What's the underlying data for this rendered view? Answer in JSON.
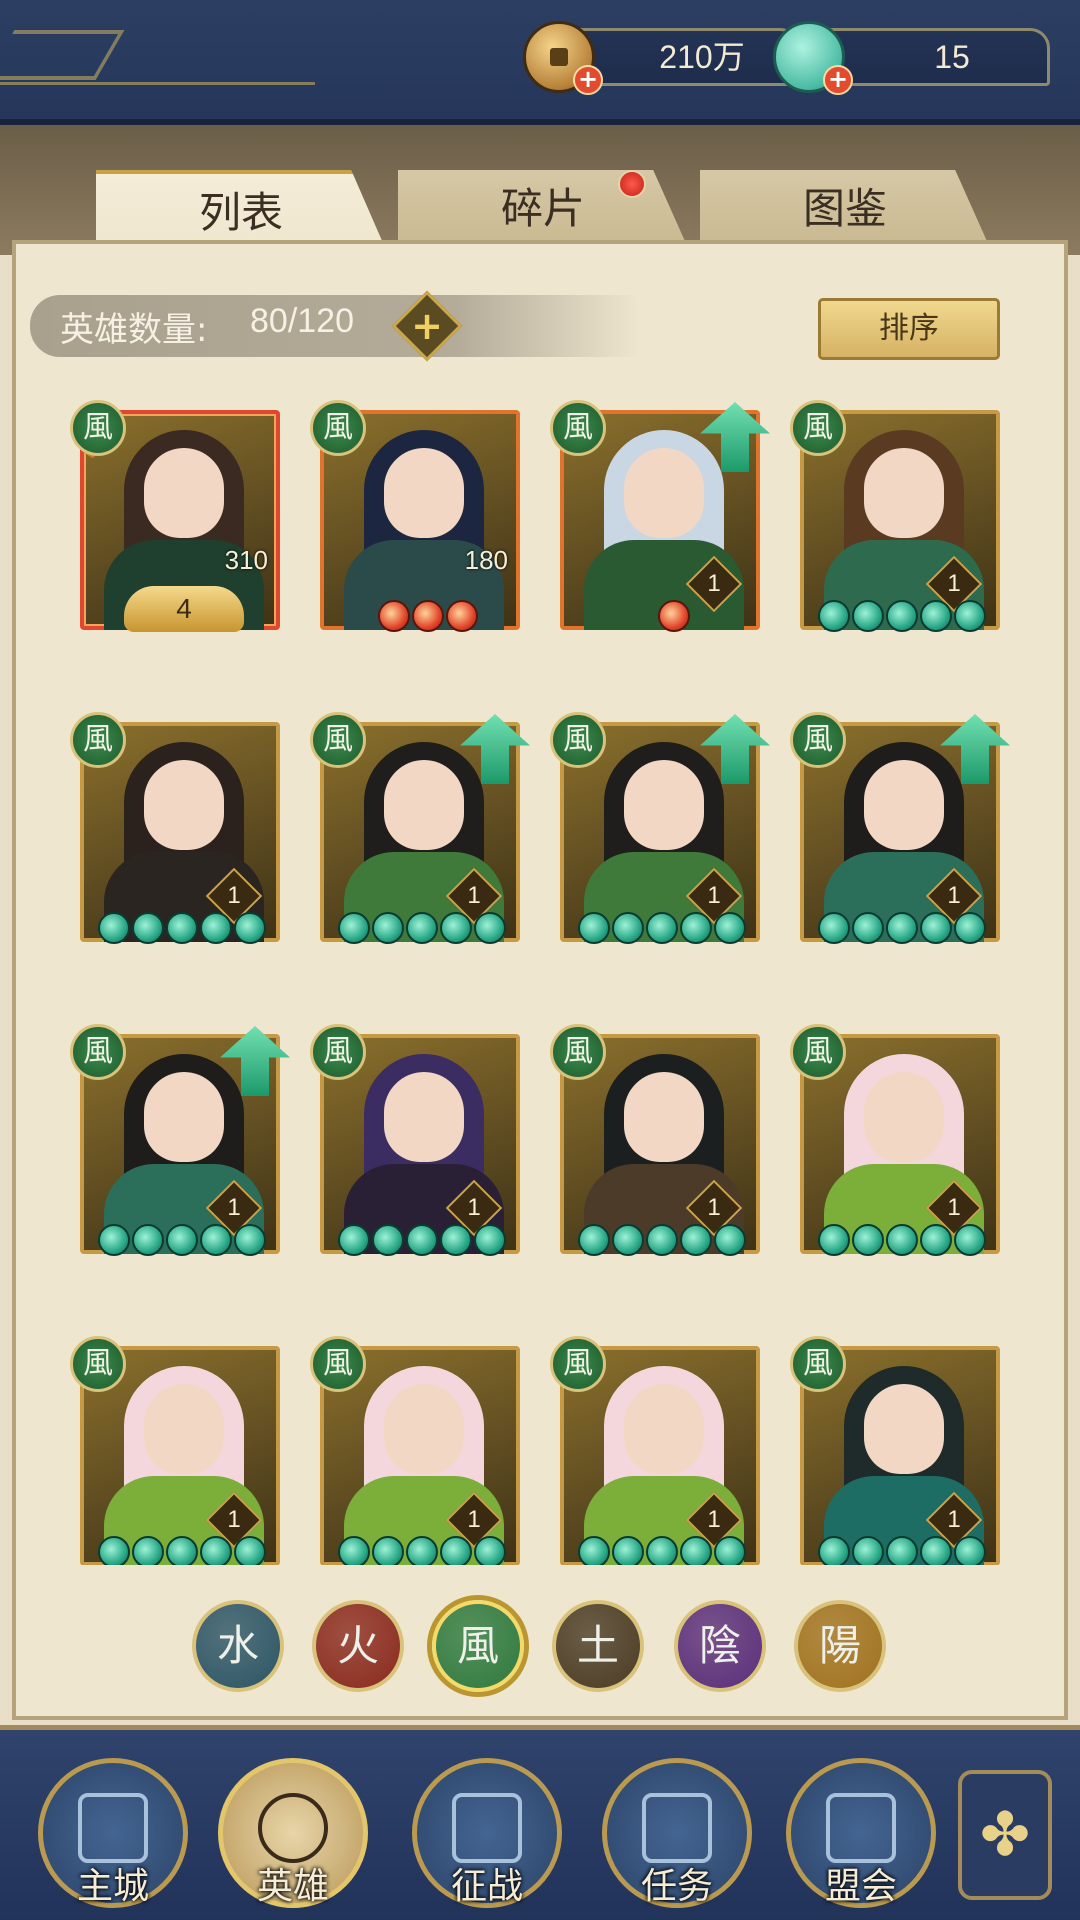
{
  "resources": {
    "coins": "210万",
    "shells": "15"
  },
  "tabs": [
    {
      "label": "列表"
    },
    {
      "label": "碎片"
    },
    {
      "label": "图鉴"
    }
  ],
  "hero_count": {
    "label": "英雄数量:",
    "value": "80/120"
  },
  "sort_label": "排序",
  "element_badge": "風",
  "heroes": [
    {
      "level": "310",
      "crest": "4",
      "hair": "#3b2a22",
      "outfit": "#20402f"
    },
    {
      "level": "180",
      "hair": "#1c2640",
      "outfit": "#2b4b4a"
    },
    {
      "level": "1",
      "hair": "#c9d6e3",
      "outfit": "#2a5a32"
    },
    {
      "level": "1",
      "hair": "#5b3a22",
      "outfit": "#2e6b4e"
    },
    {
      "level": "1",
      "hair": "#2b221e",
      "outfit": "#2a2521"
    },
    {
      "level": "1",
      "hair": "#1f1e1d",
      "outfit": "#3f7a3a"
    },
    {
      "level": "1",
      "hair": "#1f1e1d",
      "outfit": "#3f7a3a"
    },
    {
      "level": "1",
      "hair": "#1e1d1c",
      "outfit": "#2b6e59"
    },
    {
      "level": "1",
      "hair": "#1e1d1c",
      "outfit": "#2b6e59"
    },
    {
      "level": "1",
      "hair": "#3b2d62",
      "outfit": "#2a2036"
    },
    {
      "level": "1",
      "hair": "#1c1f1f",
      "outfit": "#4d3b2a"
    },
    {
      "level": "1",
      "hair": "#f3d7dd",
      "outfit": "#7cae3a"
    },
    {
      "level": "1",
      "hair": "#f3d7dd",
      "outfit": "#7cae3a"
    },
    {
      "level": "1",
      "hair": "#f3d7dd",
      "outfit": "#7cae3a"
    },
    {
      "level": "1",
      "hair": "#f3d7dd",
      "outfit": "#7cae3a"
    },
    {
      "level": "1",
      "hair": "#1f2a2a",
      "outfit": "#1e6d64"
    }
  ],
  "filters": [
    {
      "glyph": "水",
      "color": "#2c5566"
    },
    {
      "glyph": "火",
      "color": "#8a2a1e"
    },
    {
      "glyph": "風",
      "color": "#2f7a3e"
    },
    {
      "glyph": "土",
      "color": "#4b3b24"
    },
    {
      "glyph": "陰",
      "color": "#5a2e7a"
    },
    {
      "glyph": "陽",
      "color": "#a0721e"
    }
  ],
  "nav": [
    {
      "label": "主城"
    },
    {
      "label": "英雄"
    },
    {
      "label": "征战"
    },
    {
      "label": "任务"
    },
    {
      "label": "盟会"
    }
  ]
}
